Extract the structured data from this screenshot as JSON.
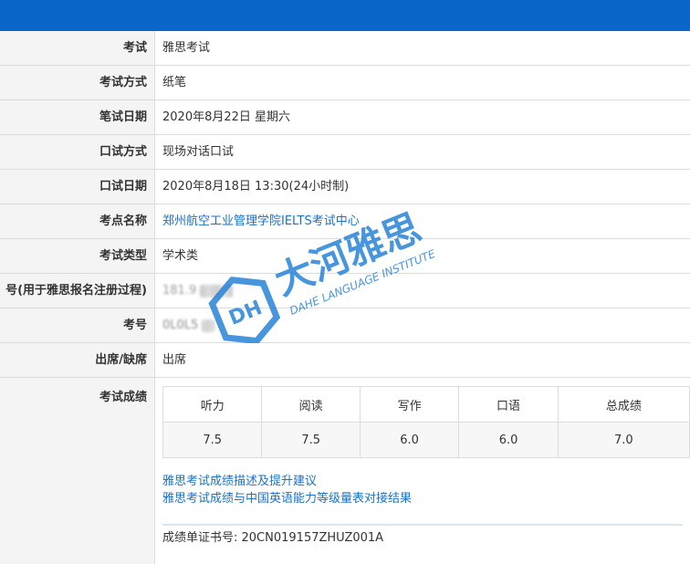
{
  "rows": [
    {
      "label": "考试",
      "value": "雅思考试"
    },
    {
      "label": "考试方式",
      "value": "纸笔"
    },
    {
      "label": "笔试日期",
      "value": "2020年8月22日 星期六"
    },
    {
      "label": "口试方式",
      "value": "现场对话口试"
    },
    {
      "label": "口试日期",
      "value": "2020年8月18日 13:30(24小时制)"
    },
    {
      "label": "考点名称",
      "value": "郑州航空工业管理学院IELTS考试中心"
    },
    {
      "label": "考试类型",
      "value": "学术类"
    },
    {
      "label": "号(用于雅思报名注册过程)",
      "value": "181.9"
    },
    {
      "label": "考号",
      "value": "0L0L5"
    },
    {
      "label": "出席/缺席",
      "value": "出席"
    }
  ],
  "score_label": "考试成绩",
  "scores": {
    "headers": [
      "听力",
      "阅读",
      "写作",
      "口语",
      "总成绩"
    ],
    "values": [
      "7.5",
      "7.5",
      "6.0",
      "6.0",
      "7.0"
    ]
  },
  "links": [
    "雅思考试成绩描述及提升建议",
    "雅思考试成绩与中国英语能力等级量表对接结果"
  ],
  "certificate": "成绩单证书号: 20CN019157ZHUZ001A",
  "watermark": {
    "brand_cn": "大河雅思",
    "brand_en": "DAHE LANGUAGE INSTITUTE",
    "logo_text": "DH"
  },
  "colors": {
    "topbar": "#0a66c9",
    "link": "#1a73c8",
    "watermark": "#1f7fd6"
  }
}
